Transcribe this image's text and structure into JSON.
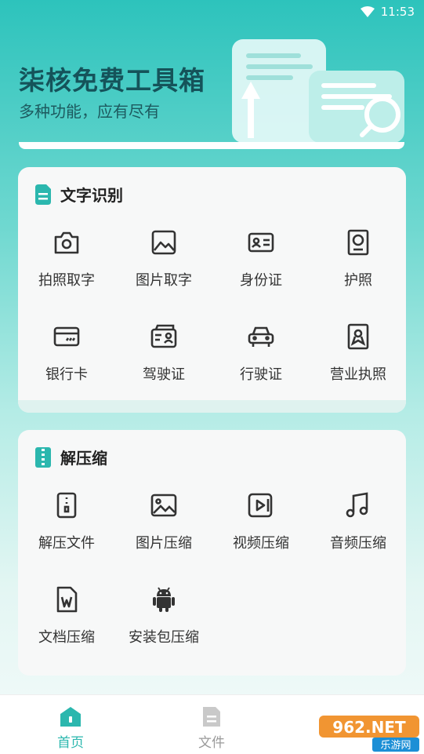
{
  "status": {
    "time": "11:53"
  },
  "hero": {
    "title": "柒核免费工具箱",
    "subtitle": "多种功能，应有尽有"
  },
  "ocr": {
    "title": "文字识别",
    "items": [
      {
        "label": "拍照取字",
        "icon": "camera-icon"
      },
      {
        "label": "图片取字",
        "icon": "image-icon"
      },
      {
        "label": "身份证",
        "icon": "id-card-icon"
      },
      {
        "label": "护照",
        "icon": "passport-icon"
      },
      {
        "label": "银行卡",
        "icon": "bank-card-icon"
      },
      {
        "label": "驾驶证",
        "icon": "driver-license-icon"
      },
      {
        "label": "行驶证",
        "icon": "car-icon"
      },
      {
        "label": "营业执照",
        "icon": "business-license-icon"
      }
    ]
  },
  "zip": {
    "title": "解压缩",
    "items": [
      {
        "label": "解压文件",
        "icon": "zip-file-icon"
      },
      {
        "label": "图片压缩",
        "icon": "image-compress-icon"
      },
      {
        "label": "视频压缩",
        "icon": "video-compress-icon"
      },
      {
        "label": "音频压缩",
        "icon": "music-note-icon"
      },
      {
        "label": "文档压缩",
        "icon": "word-document-icon"
      },
      {
        "label": "安装包压缩",
        "icon": "android-icon"
      }
    ]
  },
  "tabs": [
    {
      "label": "首页",
      "icon": "home-icon",
      "active": true
    },
    {
      "label": "文件",
      "icon": "file-icon",
      "active": false
    }
  ],
  "watermark": {
    "text": "962.NET",
    "subtext": "乐游网"
  },
  "colors": {
    "accent": "#2bb7ae",
    "title": "#15535a"
  }
}
